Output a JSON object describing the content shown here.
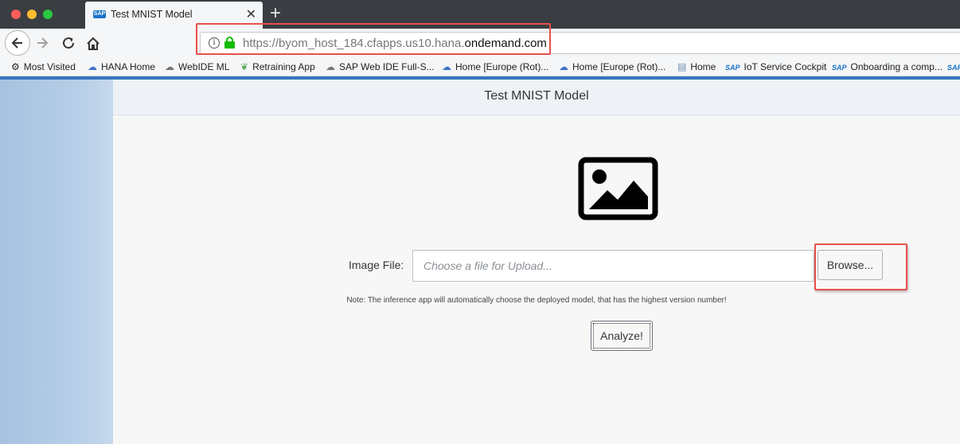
{
  "browser": {
    "tab": {
      "title": "Test MNIST Model",
      "favicon": "SAP",
      "close": "✕"
    },
    "new_tab": "+",
    "url": {
      "prefix": "https://byom_host_184.cfapps.us10.hana.",
      "domain": "ondemand.com",
      "info": "i"
    },
    "bookmarks": [
      {
        "label": "Most Visited",
        "icon": "gear-icon"
      },
      {
        "label": "HANA Home",
        "icon": "cloud-icon"
      },
      {
        "label": "WebIDE ML",
        "icon": "cloud-outline-icon"
      },
      {
        "label": "Retraining App",
        "icon": "leaf-icon"
      },
      {
        "label": "SAP Web IDE Full-S...",
        "icon": "cloud-outline-icon"
      },
      {
        "label": "Home [Europe (Rot)...",
        "icon": "cloud-icon"
      },
      {
        "label": "Home [Europe (Rot)...",
        "icon": "cloud-icon"
      },
      {
        "label": "Home",
        "icon": "page-icon"
      },
      {
        "label": "IoT Service Cockpit",
        "icon": "sap-icon"
      },
      {
        "label": "Onboarding a comp...",
        "icon": "sap-icon"
      }
    ],
    "sap_icon_text": "SAP"
  },
  "app": {
    "title": "Test MNIST Model",
    "file_label": "Image File:",
    "file_placeholder": "Choose a file for Upload...",
    "browse_label": "Browse...",
    "note": "Note: The inference app will automatically choose the deployed model, that has the highest version number!",
    "analyze_label": "Analyze!"
  },
  "colors": {
    "highlight": "#e8504a",
    "accent_stripe": "#3775bf",
    "lock_green": "#12bc00"
  }
}
